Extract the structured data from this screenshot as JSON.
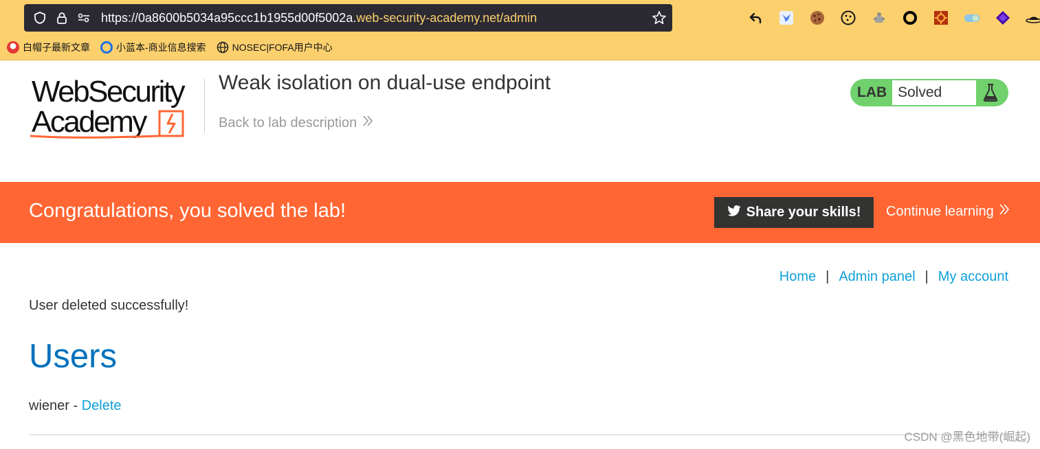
{
  "browser": {
    "url_prefix": "https://0a8600b5034a95ccc1b1955d00f5002a.",
    "url_domain": "web-security-academy.net",
    "url_path": "/admin",
    "bookmarks": [
      {
        "label": "白帽子最新文章",
        "icon": "baimaozi-icon",
        "color": "#e53935"
      },
      {
        "label": "小蓝本-商业信息搜索",
        "icon": "xiaolanben-icon",
        "color": "#1e6fe8"
      },
      {
        "label": "NOSEC|FOFA用户中心",
        "icon": "globe-icon",
        "color": "#222222"
      }
    ],
    "extensions": [
      {
        "name": "back-arrow-icon"
      },
      {
        "name": "bird-extension-icon"
      },
      {
        "name": "cookie-icon"
      },
      {
        "name": "cookie-outline-icon"
      },
      {
        "name": "puzzle-icon"
      },
      {
        "name": "ring-icon"
      },
      {
        "name": "burp-icon"
      },
      {
        "name": "toggle-icon"
      },
      {
        "name": "wappalyzer-icon"
      },
      {
        "name": "hat-icon"
      }
    ]
  },
  "header": {
    "logo_line1": "WebSecurity",
    "logo_line2": "Academy",
    "lab_title": "Weak isolation on dual-use endpoint",
    "back_link": "Back to lab description",
    "lab_badge": "LAB",
    "lab_status": "Solved"
  },
  "banner": {
    "message": "Congratulations, you solved the lab!",
    "share_button": "Share your skills!",
    "continue_link": "Continue learning"
  },
  "nav": {
    "home": "Home",
    "admin_panel": "Admin panel",
    "my_account": "My account",
    "separator": "|"
  },
  "main": {
    "status_message": "User deleted successfully!",
    "heading": "Users",
    "users": [
      {
        "name": "wiener",
        "separator": " - ",
        "action": "Delete"
      }
    ]
  },
  "watermark": "CSDN @黑色地带(崛起)",
  "colors": {
    "chrome_bg": "#fbd06d",
    "banner_bg": "#ff6633",
    "lab_solved": "#70d16d",
    "link": "#0fa0d8",
    "heading": "#0071bc"
  }
}
